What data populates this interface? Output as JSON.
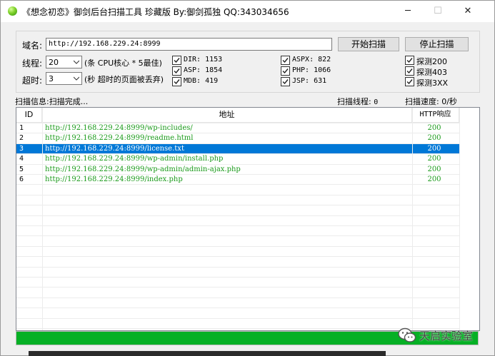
{
  "window": {
    "title": "《想念初恋》御剑后台扫描工具 珍藏版 By:御剑孤独 QQ:343034656",
    "minimize": "─",
    "maximize": "☐",
    "close": "✕"
  },
  "form": {
    "domain_label": "域名:",
    "domain_value": "http://192.168.229.24:8999",
    "threads_label": "线程:",
    "threads_value": "20",
    "threads_hint": "(条 CPU核心 * 5最佳)",
    "timeout_label": "超时:",
    "timeout_value": "3",
    "timeout_hint": "(秒 超时的页面被丢弃)",
    "start_button": "开始扫描",
    "stop_button": "停止扫描"
  },
  "dictionaries": [
    {
      "label": "DIR: 1153",
      "checked": true
    },
    {
      "label": "ASP: 1854",
      "checked": true
    },
    {
      "label": "MDB: 419",
      "checked": true
    },
    {
      "label": "ASPX: 822",
      "checked": true
    },
    {
      "label": "PHP: 1066",
      "checked": true
    },
    {
      "label": "JSP: 631",
      "checked": true
    }
  ],
  "probes": [
    {
      "label": "探测200",
      "checked": true
    },
    {
      "label": "探测403",
      "checked": true
    },
    {
      "label": "探测3XX",
      "checked": true
    }
  ],
  "status": {
    "info_label": "扫描信息:",
    "info_value": "扫描完成...",
    "threads_label": "扫描线程:",
    "threads_value": "0",
    "speed_label": "扫描速度:",
    "speed_value": "0/秒"
  },
  "results": {
    "columns": [
      "ID",
      "地址",
      "HTTP响应"
    ],
    "selected_index": 2,
    "rows": [
      {
        "id": "1",
        "url": "http://192.168.229.24:8999/wp-includes/",
        "code": "200"
      },
      {
        "id": "2",
        "url": "http://192.168.229.24:8999/readme.html",
        "code": "200"
      },
      {
        "id": "3",
        "url": "http://192.168.229.24:8999/license.txt",
        "code": "200"
      },
      {
        "id": "4",
        "url": "http://192.168.229.24:8999/wp-admin/install.php",
        "code": "200"
      },
      {
        "id": "5",
        "url": "http://192.168.229.24:8999/wp-admin/admin-ajax.php",
        "code": "200"
      },
      {
        "id": "6",
        "url": "http://192.168.229.24:8999/index.php",
        "code": "200"
      }
    ]
  },
  "progress": {
    "percent": 100,
    "color": "#06b025"
  },
  "watermark": {
    "text": "天启实验室",
    "icon": "wechat-icon"
  },
  "colors": {
    "selection": "#0078d7",
    "url_text": "#1a9a1a"
  }
}
